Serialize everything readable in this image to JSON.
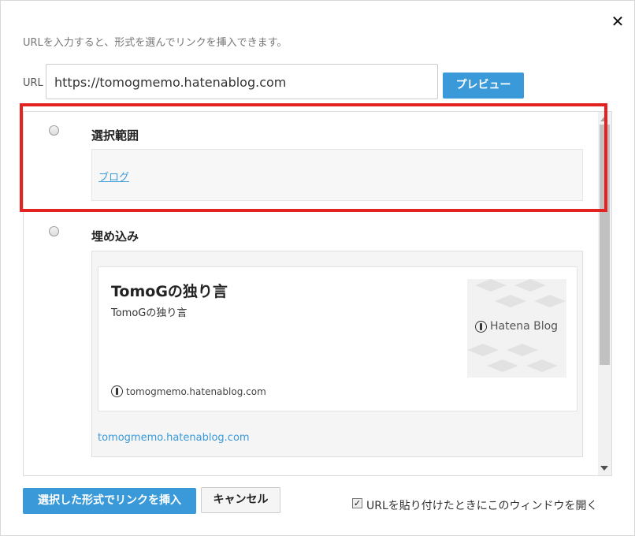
{
  "dialog": {
    "close_glyph": "✕",
    "description": "URLを入力すると、形式を選んでリンクを挿入できます。",
    "url_label": "URL",
    "url_value": "https://tomogmemo.hatenablog.com",
    "preview_label": "プレビュー"
  },
  "options": {
    "selection": {
      "title": "選択範囲",
      "link_text": "ブログ"
    },
    "embed": {
      "title": "埋め込み",
      "card_title": "TomoGの独り言",
      "card_desc": "TomoGの独り言",
      "thumb_text": "Hatena Blog",
      "card_site": "tomogmemo.hatenablog.com",
      "embed_url": "tomogmemo.hatenablog.com"
    }
  },
  "footer": {
    "insert_label": "選択した形式でリンクを挿入",
    "cancel_label": "キャンセル",
    "checkbox_checked": true,
    "checkbox_glyph": "✓",
    "checkbox_label": "URLを貼り付けたときにこのウィンドウを開く"
  },
  "colors": {
    "accent": "#3a9ad9",
    "highlight": "#e32222"
  }
}
